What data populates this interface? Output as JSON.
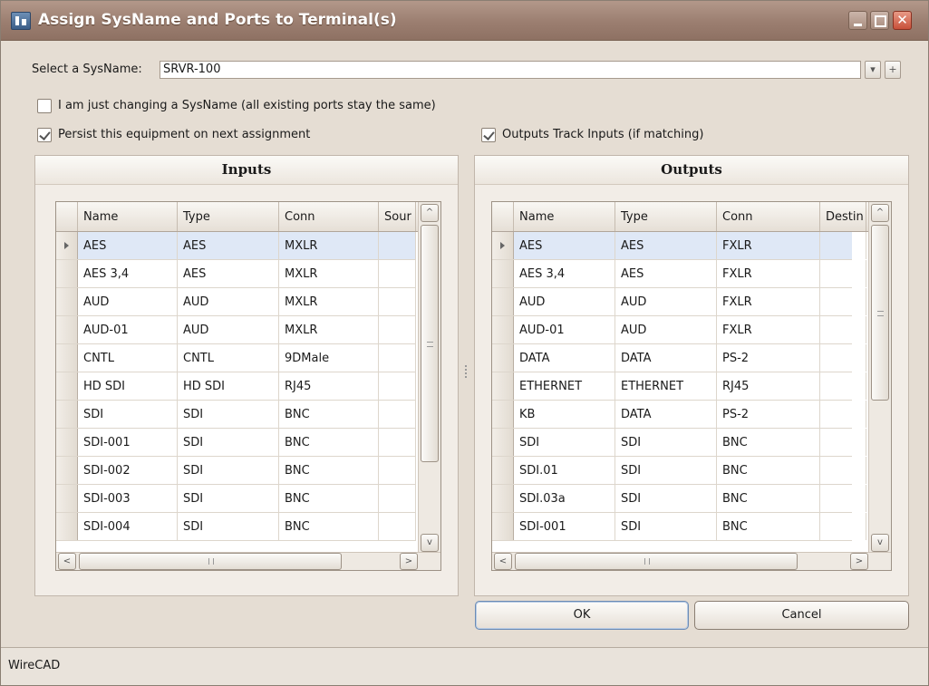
{
  "window": {
    "title": "Assign SysName and Ports to Terminal(s)",
    "close_glyph": "✕"
  },
  "sysname": {
    "label": "Select a SysName:",
    "value": "SRVR-100",
    "dropdown_glyph": "▾",
    "add_glyph": "+"
  },
  "options": {
    "changing_sysname": {
      "label": "I am just changing a SysName (all existing ports stay the same)",
      "checked": false
    },
    "persist": {
      "label": "Persist this equipment on next assignment",
      "checked": true
    },
    "outputs_track": {
      "label": "Outputs Track Inputs (if matching)",
      "checked": true
    }
  },
  "inputs": {
    "title": "Inputs",
    "columns": [
      "Name",
      "Type",
      "Conn",
      "Sour"
    ],
    "rows": [
      [
        "AES",
        "AES",
        "MXLR",
        ""
      ],
      [
        "AES 3,4",
        "AES",
        "MXLR",
        ""
      ],
      [
        "AUD",
        "AUD",
        "MXLR",
        ""
      ],
      [
        "AUD-01",
        "AUD",
        "MXLR",
        ""
      ],
      [
        "CNTL",
        "CNTL",
        "9DMale",
        ""
      ],
      [
        "HD SDI",
        "HD SDI",
        "RJ45",
        ""
      ],
      [
        "SDI",
        "SDI",
        "BNC",
        ""
      ],
      [
        "SDI-001",
        "SDI",
        "BNC",
        ""
      ],
      [
        "SDI-002",
        "SDI",
        "BNC",
        ""
      ],
      [
        "SDI-003",
        "SDI",
        "BNC",
        ""
      ],
      [
        "SDI-004",
        "SDI",
        "BNC",
        ""
      ]
    ],
    "selected_row": 0
  },
  "outputs": {
    "title": "Outputs",
    "columns": [
      "Name",
      "Type",
      "Conn",
      "Destin"
    ],
    "rows": [
      [
        "AES",
        "AES",
        "FXLR",
        ""
      ],
      [
        "AES 3,4",
        "AES",
        "FXLR",
        ""
      ],
      [
        "AUD",
        "AUD",
        "FXLR",
        ""
      ],
      [
        "AUD-01",
        "AUD",
        "FXLR",
        ""
      ],
      [
        "DATA",
        "DATA",
        "PS-2",
        ""
      ],
      [
        "ETHERNET",
        "ETHERNET",
        "RJ45",
        ""
      ],
      [
        "KB",
        "DATA",
        "PS-2",
        ""
      ],
      [
        "SDI",
        "SDI",
        "BNC",
        ""
      ],
      [
        "SDI.01",
        "SDI",
        "BNC",
        ""
      ],
      [
        "SDI.03a",
        "SDI",
        "BNC",
        ""
      ],
      [
        "SDI-001",
        "SDI",
        "BNC",
        ""
      ]
    ],
    "selected_row": 0
  },
  "buttons": {
    "ok": "OK",
    "cancel": "Cancel"
  },
  "scroll": {
    "up": "^",
    "down": "v",
    "left": "<",
    "right": ">"
  },
  "status": {
    "text": "WireCAD"
  },
  "icons": [
    "app-icon",
    "minimize-icon",
    "maximize-icon",
    "close-icon",
    "dropdown-icon",
    "add-icon",
    "row-pointer-icon",
    "checkmark-icon"
  ]
}
